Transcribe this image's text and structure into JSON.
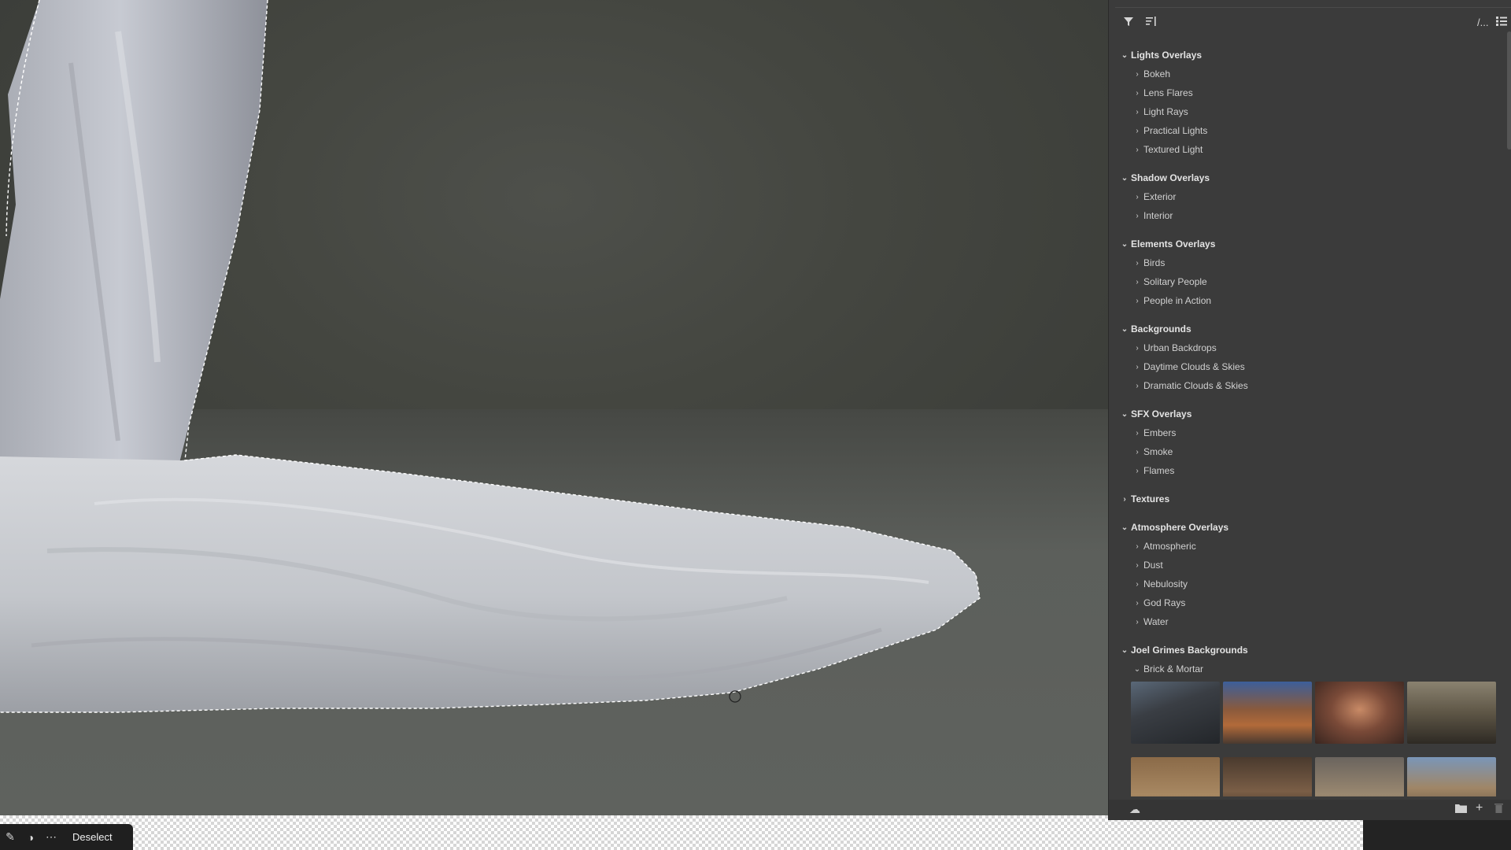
{
  "taskbar": {
    "deselect_label": "Deselect",
    "icons": [
      "brush-icon",
      "mask-icon",
      "more-icon"
    ]
  },
  "panel": {
    "toolbar_icons": [
      "filter-icon",
      "sort-icon",
      "path-icon",
      "list-view-icon"
    ],
    "groups": [
      {
        "label": "Lights Overlays",
        "expanded": true,
        "items": [
          "Bokeh",
          "Lens Flares",
          "Light Rays",
          "Practical Lights",
          "Textured Light"
        ]
      },
      {
        "label": "Shadow Overlays",
        "expanded": true,
        "items": [
          "Exterior",
          "Interior"
        ]
      },
      {
        "label": "Elements Overlays",
        "expanded": true,
        "items": [
          "Birds",
          "Solitary People",
          "People in Action"
        ]
      },
      {
        "label": "Backgrounds",
        "expanded": true,
        "items": [
          "Urban Backdrops",
          "Daytime Clouds & Skies",
          "Dramatic Clouds & Skies"
        ]
      },
      {
        "label": "SFX Overlays",
        "expanded": true,
        "items": [
          "Embers",
          "Smoke",
          "Flames"
        ]
      },
      {
        "label": "Textures",
        "expanded": false,
        "items": []
      },
      {
        "label": "Atmosphere Overlays",
        "expanded": true,
        "items": [
          "Atmospheric",
          "Dust",
          "Nebulosity",
          "God Rays",
          "Water"
        ]
      },
      {
        "label": "Joel Grimes Backgrounds",
        "expanded": true,
        "items": [
          "Brick & Mortar"
        ]
      }
    ],
    "bottom_icons": [
      "cloud-icon",
      "folder-icon",
      "add-icon",
      "trash-icon"
    ]
  },
  "colors": {
    "panel_bg": "#3b3b3b",
    "canvas_bg": "#444640",
    "fabric": "#c9ccd0"
  }
}
